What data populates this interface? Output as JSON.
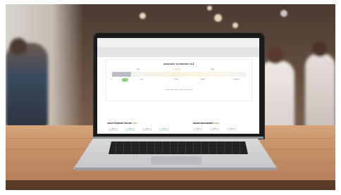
{
  "screen": {
    "card_title": "RESOURCE TO PERCENT TILE",
    "scale_labels": [
      "LOW",
      "MEDIUM",
      "HIGH"
    ],
    "progress": 0.14,
    "ticks": [
      "0",
      "200",
      "1,000",
      "5,000",
      "20,000+"
    ],
    "card_note": "Lorem ipsum dolor sit amet, consectetur",
    "left_section": {
      "title": "AGENT SUMMARY REPORT",
      "accent": "VIEW"
    },
    "right_section": {
      "title": "BRAND ENGAGEMENT",
      "accent": "VIEW"
    },
    "left_chips": [
      "Item",
      "Item",
      "Item",
      "Item"
    ],
    "right_chips": [
      "Item",
      "Item",
      "Item"
    ]
  },
  "colors": {
    "accent_green": "#7fbf5a",
    "marker_green": "#8fd07a",
    "bar_gray": "#b9bec6"
  }
}
